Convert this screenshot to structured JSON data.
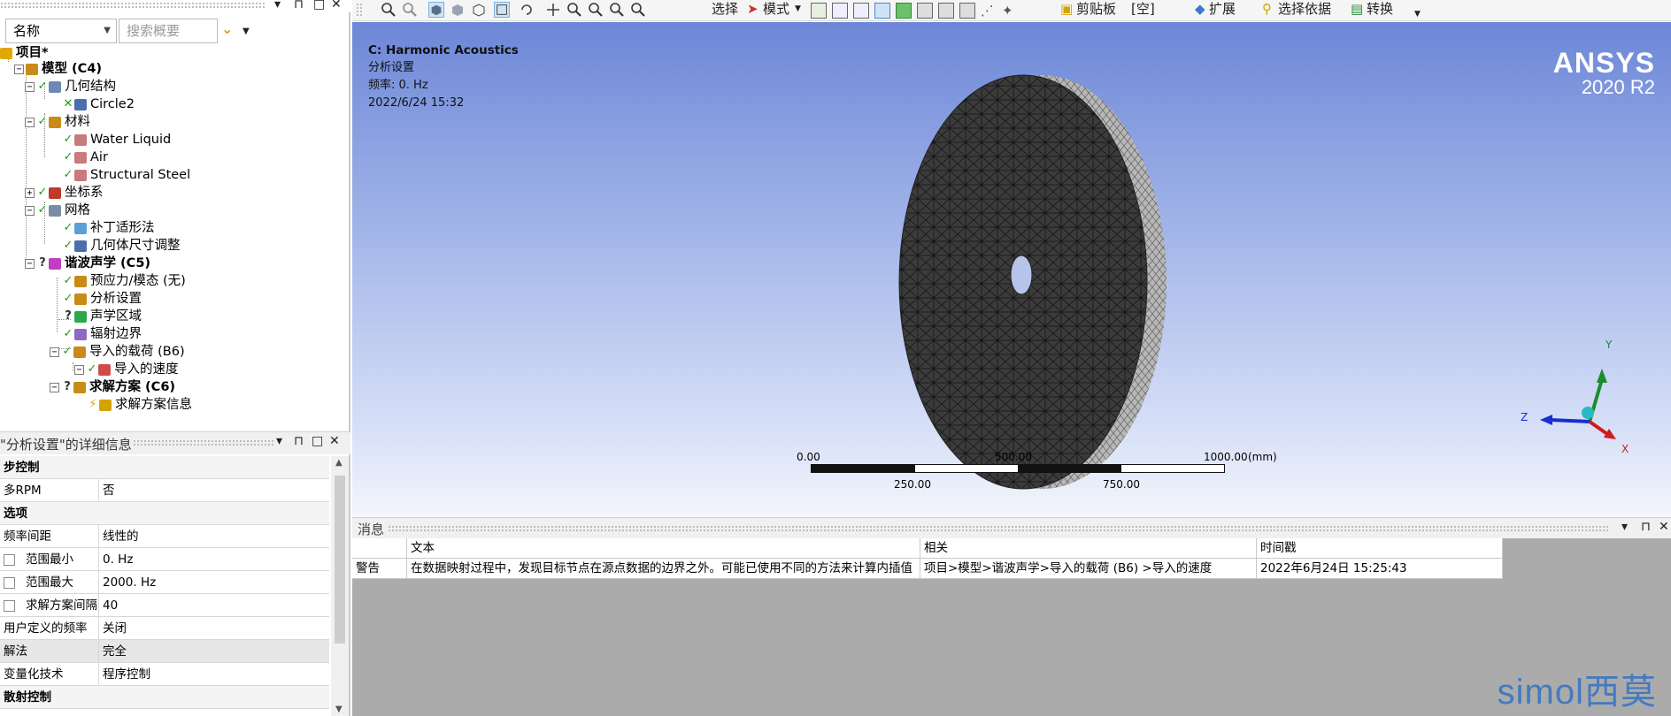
{
  "outline": {
    "header_buttons": [
      "▾",
      "⊓",
      "□",
      "✕"
    ],
    "name_combo": "名称",
    "search_placeholder": "搜索概要",
    "filter_icon": "chevron-filter-icon",
    "nodes": [
      {
        "label": "项目*",
        "bold": true,
        "icon": "project-icon",
        "status": ""
      },
      {
        "label": "模型 (C4)",
        "bold": true,
        "icon": "model-icon",
        "status": ""
      },
      {
        "label": "几何结构",
        "bold": false,
        "icon": "geometry-icon",
        "status": "ok"
      },
      {
        "label": "Circle2",
        "bold": false,
        "icon": "body-icon",
        "status": "partial"
      },
      {
        "label": "材料",
        "bold": false,
        "icon": "materials-icon",
        "status": "ok"
      },
      {
        "label": "Water Liquid",
        "bold": false,
        "icon": "material-tag-icon",
        "status": "ok"
      },
      {
        "label": "Air",
        "bold": false,
        "icon": "material-tag-icon",
        "status": "ok"
      },
      {
        "label": "Structural Steel",
        "bold": false,
        "icon": "material-tag-icon",
        "status": "ok"
      },
      {
        "label": "坐标系",
        "bold": false,
        "icon": "coordinate-system-icon",
        "status": "ok"
      },
      {
        "label": "网格",
        "bold": false,
        "icon": "mesh-icon",
        "status": "ok"
      },
      {
        "label": "补丁适形法",
        "bold": false,
        "icon": "mesh-method-icon",
        "status": "ok"
      },
      {
        "label": "几何体尺寸调整",
        "bold": false,
        "icon": "body-sizing-icon",
        "status": "ok"
      },
      {
        "label": "谐波声学 (C5)",
        "bold": true,
        "icon": "harmonic-acoustics-icon",
        "status": "question"
      },
      {
        "label": "预应力/模态 (无)",
        "bold": false,
        "icon": "prestress-icon",
        "status": "ok"
      },
      {
        "label": "分析设置",
        "bold": false,
        "icon": "analysis-settings-icon",
        "status": "ok"
      },
      {
        "label": "声学区域",
        "bold": false,
        "icon": "acoustic-region-icon",
        "status": "question"
      },
      {
        "label": "辐射边界",
        "bold": false,
        "icon": "radiation-boundary-icon",
        "status": "ok"
      },
      {
        "label": "导入的载荷 (B6)",
        "bold": false,
        "icon": "imported-load-icon",
        "status": "ok"
      },
      {
        "label": "导入的速度",
        "bold": false,
        "icon": "imported-velocity-icon",
        "status": "ok"
      },
      {
        "label": "求解方案 (C6)",
        "bold": true,
        "icon": "solution-icon",
        "status": "question"
      },
      {
        "label": "求解方案信息",
        "bold": false,
        "icon": "solution-info-icon",
        "status": "bolt"
      }
    ]
  },
  "details": {
    "title": "\"分析设置\"的详细信息",
    "header_buttons": [
      "▾",
      "⊓",
      "□",
      "✕"
    ],
    "rows": [
      {
        "key": "步控制",
        "value": "",
        "section": true
      },
      {
        "key": "多RPM",
        "value": "否",
        "section": false
      },
      {
        "key": "选项",
        "value": "",
        "section": true
      },
      {
        "key": "频率间距",
        "value": "线性的",
        "section": false
      },
      {
        "key": "范围最小",
        "value": "0. Hz",
        "section": false,
        "checkbox": true
      },
      {
        "key": "范围最大",
        "value": "2000. Hz",
        "section": false,
        "checkbox": true
      },
      {
        "key": "求解方案间隔",
        "value": "40",
        "section": false,
        "checkbox": true
      },
      {
        "key": "用户定义的频率",
        "value": "关闭",
        "section": false
      },
      {
        "key": "解法",
        "value": "完全",
        "section": false,
        "selected": true
      },
      {
        "key": "变量化技术",
        "value": "程序控制",
        "section": false
      },
      {
        "key": "散射控制",
        "value": "",
        "section": true
      }
    ]
  },
  "toolbar": {
    "items": [
      "选择",
      "模式",
      "剪贴板",
      "[空]",
      "扩展",
      "选择依据",
      "转换"
    ]
  },
  "viewport": {
    "info_title": "C: Harmonic Acoustics",
    "info_line2": "分析设置",
    "info_line3": "频率: 0.   Hz",
    "info_line4": "2022/6/24 15:32",
    "brand": "ANSYS",
    "version": "2020 R2",
    "scale_top_left": "0.00",
    "scale_top_mid": "500.00",
    "scale_top_right": "1000.00",
    "scale_unit": "(mm)",
    "scale_bottom_1": "250.00",
    "scale_bottom_2": "750.00",
    "axis_x": "X",
    "axis_y": "Y",
    "axis_z": "Z",
    "colors": {
      "axis_x": "#d11a1a",
      "axis_y": "#1a8c2a",
      "axis_z": "#1a2ed1",
      "mesh_face": "#3b3b3b"
    }
  },
  "messages": {
    "title": "消息",
    "header_buttons": [
      "▾",
      "⊓",
      "✕"
    ],
    "columns": [
      "文本",
      "相关",
      "时间戳"
    ],
    "rows": [
      {
        "type": "警告",
        "text": "在数据映射过程中，发现目标节点在源点数据的边界之外。可能已使用不同的方法来计算内插值",
        "related": "项目>模型>谐波声学>导入的载荷 (B6) >导入的速度",
        "time": "2022年6月24日 15:25:43"
      }
    ]
  },
  "watermark": "simol西莫"
}
